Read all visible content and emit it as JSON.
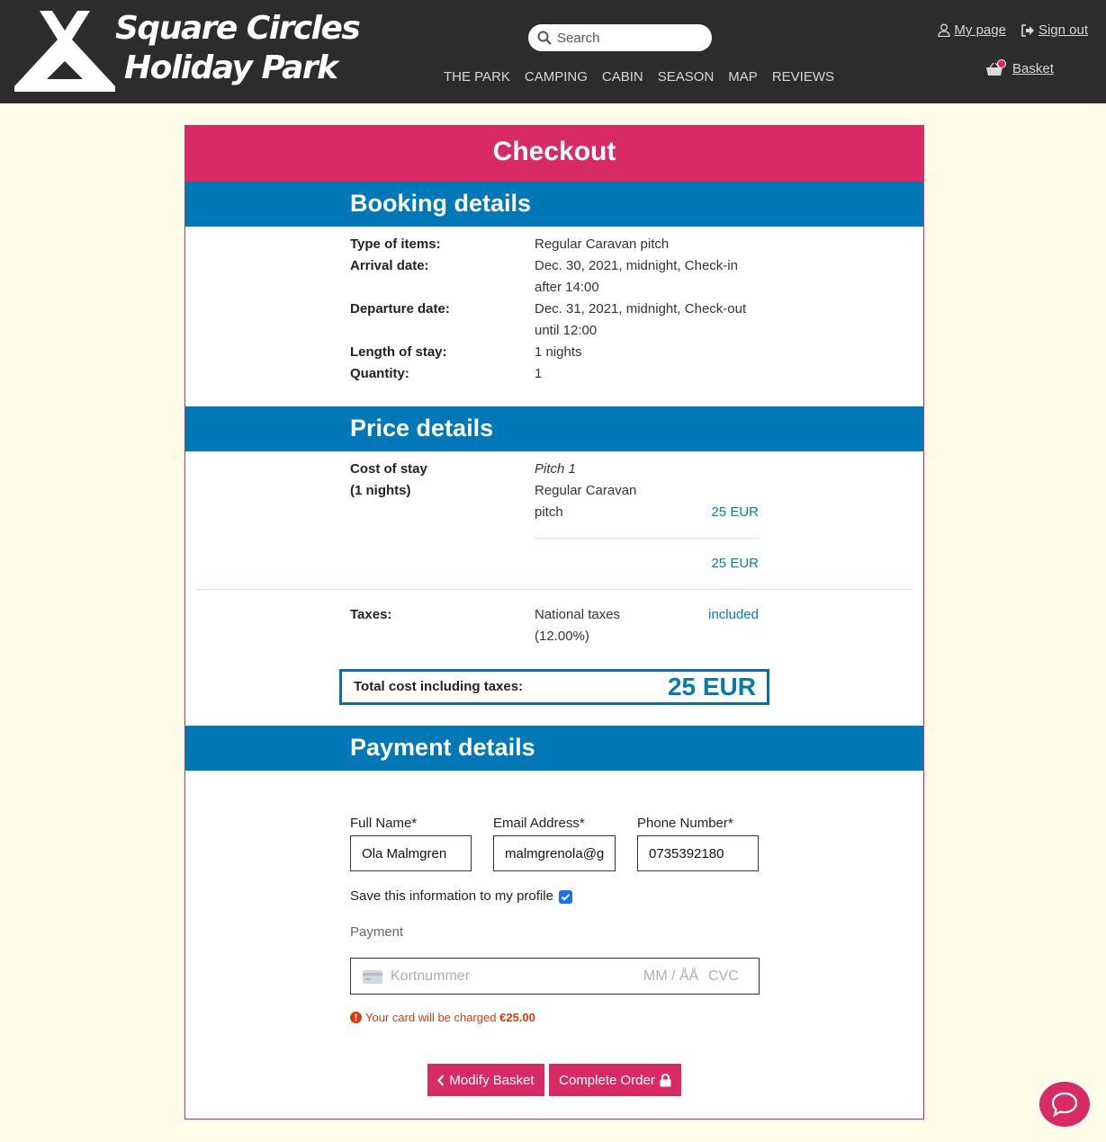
{
  "header": {
    "brand_line1": "Square Circles",
    "brand_line2": "Holiday Park",
    "search_placeholder": "Search",
    "nav": [
      "THE PARK",
      "CAMPING",
      "CABIN",
      "SEASON",
      "MAP",
      "REVIEWS"
    ],
    "my_page": "My page",
    "sign_out": "Sign out",
    "basket": "Basket"
  },
  "checkout": {
    "title": "Checkout",
    "booking": {
      "heading": "Booking details",
      "type_label": "Type of items:",
      "type_value": "Regular Caravan pitch",
      "arrival_label": "Arrival date:",
      "arrival_value_1": "Dec. 30, 2021, midnight, Check-in",
      "arrival_value_2": "after 14:00",
      "departure_label": "Departure date:",
      "departure_value_1": "Dec. 31, 2021, midnight, Check-out",
      "departure_value_2": "until 12:00",
      "length_label": "Length of stay:",
      "length_value": "1 nights",
      "quantity_label": "Quantity:",
      "quantity_value": "1"
    },
    "price": {
      "heading": "Price details",
      "cost_label_1": "Cost of stay",
      "cost_label_2": "(1 nights)",
      "pitch_name": "Pitch 1",
      "pitch_type_1": "Regular Caravan",
      "pitch_type_2": "pitch",
      "pitch_price": "25 EUR",
      "subtotal": "25 EUR",
      "taxes_label": "Taxes:",
      "tax_name_1": "National taxes",
      "tax_name_2": "(12.00%)",
      "tax_value": "included",
      "total_label": "Total cost including taxes:",
      "total_value": "25 EUR"
    },
    "payment": {
      "heading": "Payment details",
      "full_name_label": "Full Name*",
      "full_name_value": "Ola Malmgren",
      "email_label": "Email Address*",
      "email_value": "malmgrenola@g",
      "phone_label": "Phone Number*",
      "phone_value": "0735392180",
      "save_label": "Save this information to my profile",
      "save_checked": true,
      "payment_label": "Payment",
      "card_placeholder": "Kortnummer",
      "expiry_placeholder": "MM / ÅÅ",
      "cvc_placeholder": "CVC",
      "notice_prefix": "Your card will be charged ",
      "notice_amount": "€25.00",
      "modify_button": "Modify Basket",
      "complete_button": "Complete Order"
    }
  },
  "colors": {
    "header_bg": "#2c2c2c",
    "accent_pink": "#d82a64",
    "section_blue": "#0077b6",
    "price_blue": "#0a7aa9",
    "page_bg": "#fefde8"
  }
}
